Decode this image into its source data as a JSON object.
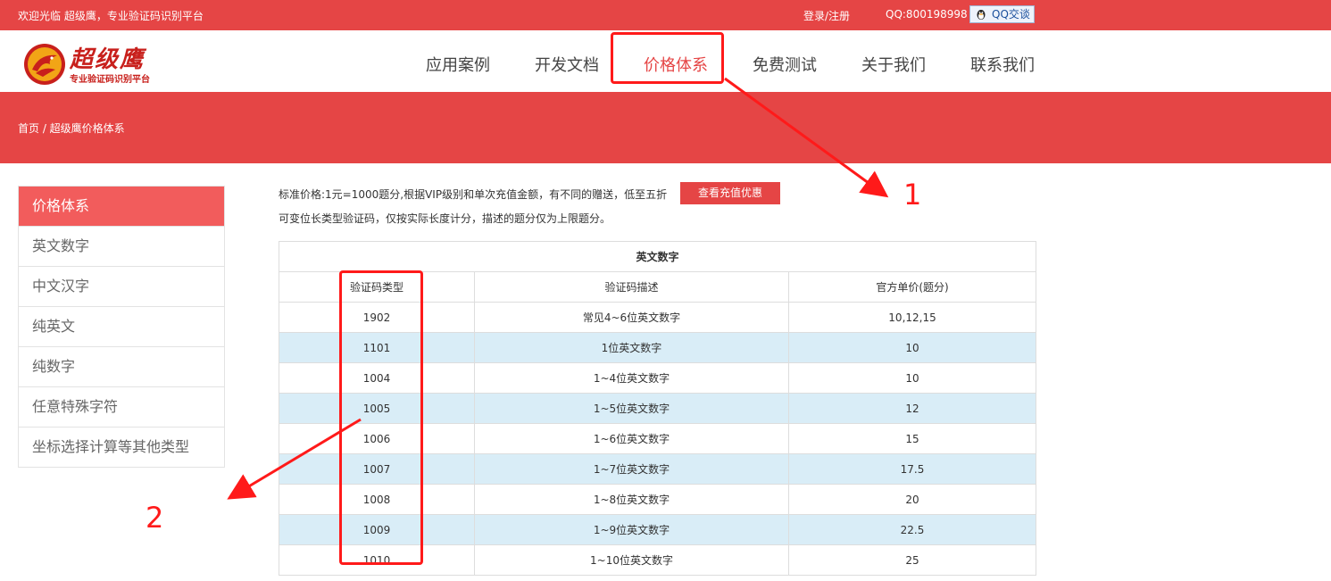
{
  "topbar": {
    "welcome": "欢迎光临 超级鹰，专业验证码识别平台",
    "login": "登录/注册",
    "qq": "QQ:800198998",
    "qq_button": "QQ交谈"
  },
  "logo": {
    "brand": "超级鹰",
    "tagline": "专业验证码识别平台"
  },
  "nav": [
    {
      "label": "应用案例"
    },
    {
      "label": "开发文档"
    },
    {
      "label": "价格体系"
    },
    {
      "label": "免费测试"
    },
    {
      "label": "关于我们"
    },
    {
      "label": "联系我们"
    }
  ],
  "breadcrumb": "首页 / 超级鹰价格体系",
  "sidebar": [
    {
      "label": "价格体系"
    },
    {
      "label": "英文数字"
    },
    {
      "label": "中文汉字"
    },
    {
      "label": "纯英文"
    },
    {
      "label": "纯数字"
    },
    {
      "label": "任意特殊字符"
    },
    {
      "label": "坐标选择计算等其他类型"
    }
  ],
  "info": {
    "line1": "标准价格:1元=1000题分,根据VIP级别和单次充值金额，有不同的赠送，低至五折",
    "line2": "可变位长类型验证码，仅按实际长度计分，描述的题分仅为上限题分。",
    "charge_button": "查看充值优惠"
  },
  "table": {
    "caption": "英文数字",
    "headers": [
      "验证码类型",
      "验证码描述",
      "官方单价(题分)"
    ],
    "rows": [
      [
        "1902",
        "常见4~6位英文数字",
        "10,12,15"
      ],
      [
        "1101",
        "1位英文数字",
        "10"
      ],
      [
        "1004",
        "1~4位英文数字",
        "10"
      ],
      [
        "1005",
        "1~5位英文数字",
        "12"
      ],
      [
        "1006",
        "1~6位英文数字",
        "15"
      ],
      [
        "1007",
        "1~7位英文数字",
        "17.5"
      ],
      [
        "1008",
        "1~8位英文数字",
        "20"
      ],
      [
        "1009",
        "1~9位英文数字",
        "22.5"
      ],
      [
        "1010",
        "1~10位英文数字",
        "25"
      ]
    ]
  },
  "annotations": {
    "label1": "1",
    "label2": "2",
    "color": "#ff1a1a"
  },
  "colors": {
    "brand_red": "#e54545",
    "sidebar_active": "#f25c5c",
    "row_alt": "#d9edf7"
  }
}
